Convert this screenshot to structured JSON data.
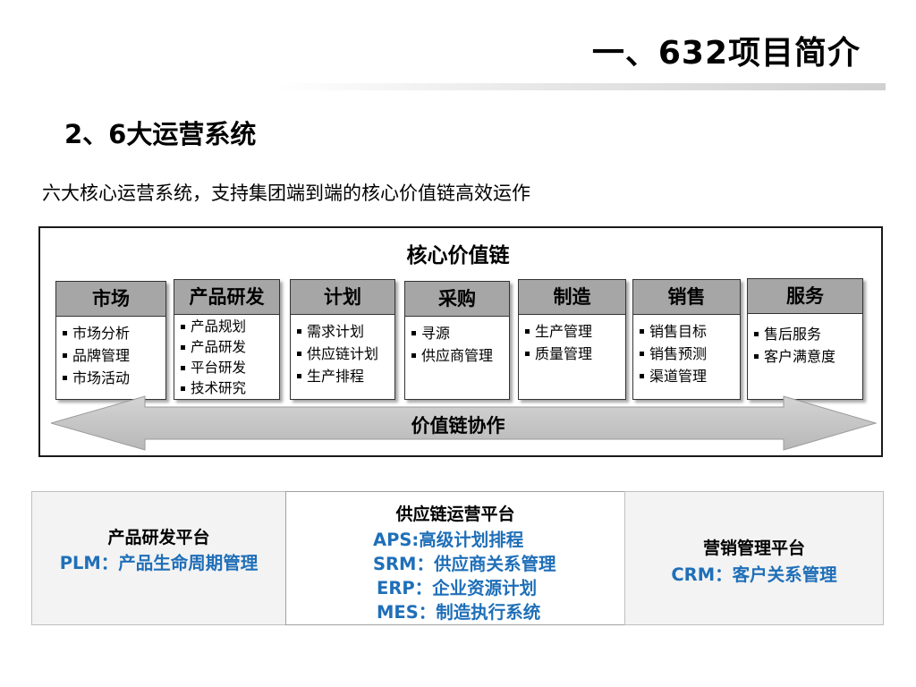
{
  "page": {
    "title": "一、632项目简介",
    "section_heading": "2、6大运营系统",
    "intro": "六大核心运营系统，支持集团端到端的核心价值链高效运作"
  },
  "value_chain": {
    "title": "核心价值链",
    "arrow_label": "价值链协作",
    "columns": [
      {
        "head": "市场",
        "items": [
          "市场分析",
          "品牌管理",
          "市场活动"
        ]
      },
      {
        "head": "产品研发",
        "items": [
          "产品规划",
          "产品研发",
          "平台研发",
          "技术研究"
        ]
      },
      {
        "head": "计划",
        "items": [
          "需求计划",
          "供应链计划",
          "生产排程"
        ]
      },
      {
        "head": "采购",
        "items": [
          "寻源",
          "供应商管理"
        ]
      },
      {
        "head": "制造",
        "items": [
          "生产管理",
          "质量管理"
        ]
      },
      {
        "head": "销售",
        "items": [
          "销售目标",
          "销售预测",
          "渠道管理"
        ]
      },
      {
        "head": "服务",
        "items": [
          "售后服务",
          "客户满意度"
        ]
      }
    ]
  },
  "platforms": {
    "plm": {
      "name": "产品研发平台",
      "system": "PLM：产品生命周期管理"
    },
    "scm": {
      "name": "供应链运营平台",
      "systems": [
        "APS:高级计划排程",
        "SRM：供应商关系管理",
        "ERP：企业资源计划",
        "MES：制造执行系统"
      ]
    },
    "crm": {
      "name": "营销管理平台",
      "system": "CRM：客户关系管理"
    }
  },
  "colors": {
    "accent_blue": "#1f6fb8",
    "column_header_gray": "#a6a6a6",
    "arrow_gray": "#bfbfbf"
  }
}
